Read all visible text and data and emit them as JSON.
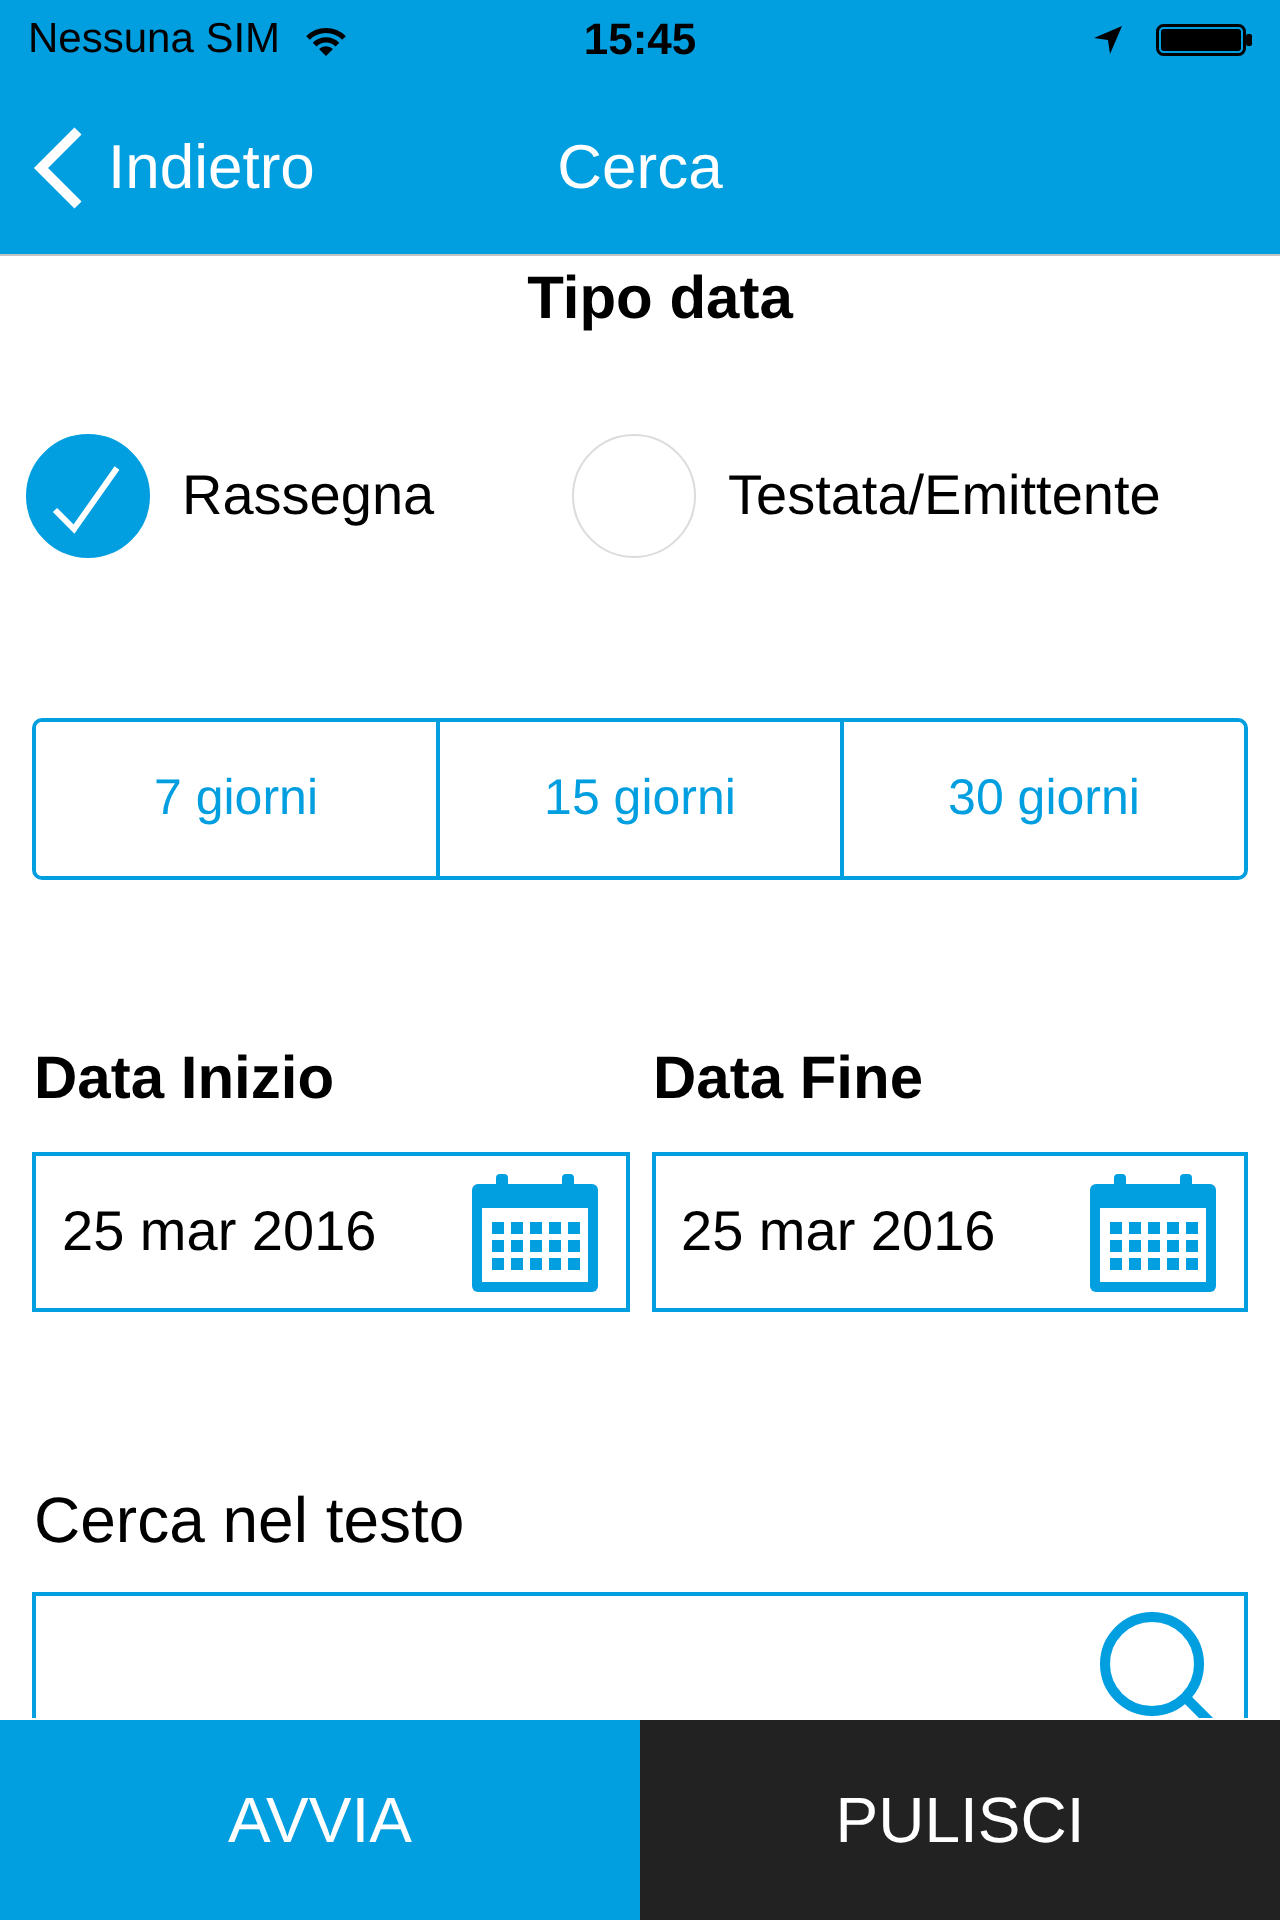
{
  "status_bar": {
    "carrier": "Nessuna SIM",
    "time": "15:45"
  },
  "nav": {
    "back": "Indietro",
    "title": "Cerca"
  },
  "date_type": {
    "title": "Tipo data",
    "options": [
      {
        "label": "Rassegna",
        "selected": true
      },
      {
        "label": "Testata/Emittente",
        "selected": false
      }
    ]
  },
  "periods": [
    {
      "label": "7 giorni",
      "selected": false
    },
    {
      "label": "15 giorni",
      "selected": false
    },
    {
      "label": "30 giorni",
      "selected": false
    }
  ],
  "dates": [
    {
      "label": "Data Inizio",
      "value": "25 mar 2016"
    },
    {
      "label": "Data Fine",
      "value": "25 mar 2016"
    }
  ],
  "search": {
    "label": "Cerca nel testo"
  },
  "buttons": [
    {
      "label": "AVVIA",
      "kind": "primary"
    },
    {
      "label": "PULISCI",
      "kind": "secondary"
    }
  ]
}
